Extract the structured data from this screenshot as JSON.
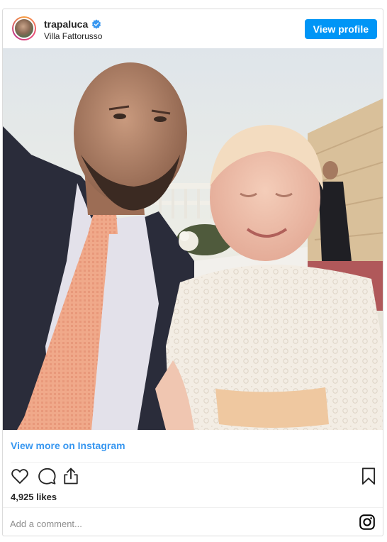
{
  "header": {
    "username": "trapaluca",
    "location": "Villa Fattorusso",
    "view_profile_label": "View profile"
  },
  "post": {
    "image_alt": "Photo of a man with a young child in a white lace dress"
  },
  "footer": {
    "view_more_label": "View more on Instagram",
    "likes_text": "4,925 likes",
    "comment_placeholder": "Add a comment..."
  },
  "icons": {
    "verified": "verified-badge-icon",
    "like": "heart-icon",
    "comment": "comment-bubble-icon",
    "share": "share-icon",
    "save": "bookmark-icon",
    "instagram": "instagram-logo-icon"
  },
  "colors": {
    "accent": "#0095f6",
    "link": "#3897f0",
    "text": "#262626",
    "muted": "#8e8e8e",
    "border": "#dbdbdb"
  }
}
